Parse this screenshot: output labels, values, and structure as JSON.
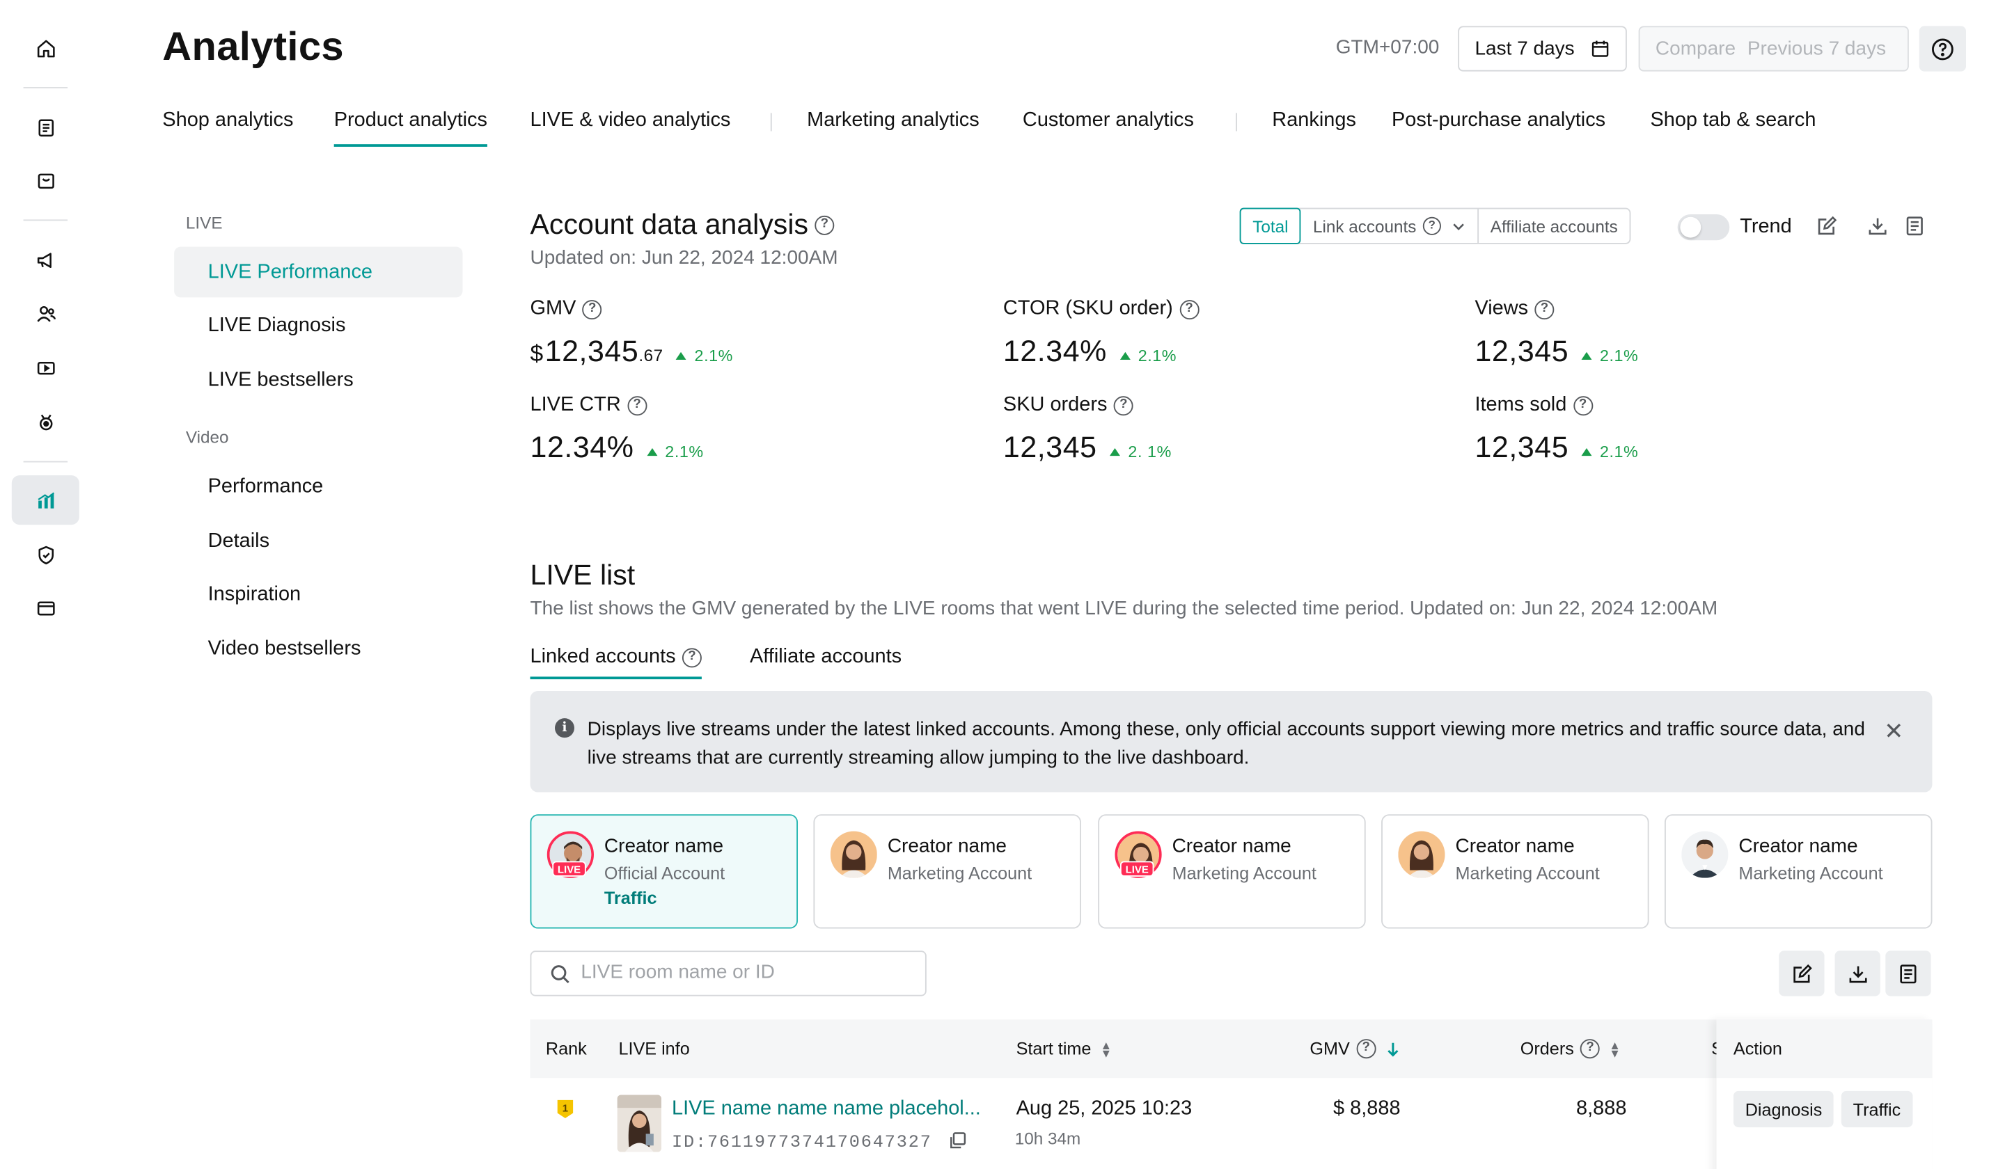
{
  "header": {
    "title": "Analytics",
    "timezone": "GTM+07:00",
    "date_range": "Last 7 days",
    "compare_label": "Compare",
    "compare_range": "Previous 7 days"
  },
  "tabs": [
    {
      "label": "Shop analytics"
    },
    {
      "label": "Product analytics"
    },
    {
      "label": "LIVE & video analytics"
    },
    {
      "label": "Marketing analytics"
    },
    {
      "label": "Customer analytics"
    },
    {
      "label": "Rankings"
    },
    {
      "label": "Post-purchase analytics"
    },
    {
      "label": "Shop tab &  search"
    }
  ],
  "sidenav": {
    "live_group": "LIVE",
    "live_items": [
      "LIVE Performance",
      "LIVE Diagnosis",
      "LIVE bestsellers"
    ],
    "video_group": "Video",
    "video_items": [
      "Performance",
      "Details",
      "Inspiration",
      "Video bestsellers"
    ]
  },
  "account": {
    "title": "Account data analysis",
    "updated": "Updated on: Jun 22, 2024 12:00AM",
    "segments": [
      "Total",
      "Link accounts",
      "Affiliate accounts"
    ],
    "trend_label": "Trend",
    "metrics": [
      {
        "label": "GMV",
        "currency": "$",
        "value": "12,345",
        "decimal": ".67",
        "change": "2.1%"
      },
      {
        "label": "CTOR (SKU order)",
        "value": "12.34%",
        "change": "2.1%"
      },
      {
        "label": "Views",
        "value": "12,345",
        "change": "2.1%"
      },
      {
        "label": "LIVE CTR",
        "value": "12.34%",
        "change": "2.1%"
      },
      {
        "label": "SKU orders",
        "value": "12,345",
        "change": "2. 1%"
      },
      {
        "label": "Items sold",
        "value": "12,345",
        "change": "2.1%"
      }
    ]
  },
  "live_list": {
    "title": "LIVE list",
    "description": "The list shows the GMV generated by the LIVE rooms that went LIVE during the selected time period. Updated on: Jun 22, 2024 12:00AM",
    "subtabs": [
      "Linked accounts",
      "Affiliate accounts"
    ],
    "banner": "Displays live streams under the latest linked accounts. Among these, only official accounts support viewing more metrics and traffic source data, and live streams that are currently streaming allow jumping to the live dashboard.",
    "creators": [
      {
        "name": "Creator name",
        "type": "Official Account",
        "link": "Traffic",
        "live": "LIVE"
      },
      {
        "name": "Creator name",
        "type": "Marketing Account"
      },
      {
        "name": "Creator name",
        "type": "Marketing Account",
        "live": "LIVE"
      },
      {
        "name": "Creator name",
        "type": "Marketing Account"
      },
      {
        "name": "Creator name",
        "type": "Marketing Account"
      }
    ],
    "search_placeholder": "LIVE room name or ID",
    "columns": [
      "Rank",
      "LIVE info",
      "Start time",
      "GMV",
      "Orders",
      "S",
      "Action"
    ],
    "rows": [
      {
        "rank": "1",
        "name": "LIVE name name name placehol...",
        "id": "ID:7611977374170647327",
        "start_time": "Aug 25, 2025 10:23",
        "duration": "10h 34m",
        "gmv": "$ 8,888",
        "orders": "8,888",
        "actions": [
          "Diagnosis",
          "Traffic"
        ]
      }
    ]
  },
  "colors": {
    "accent": "#009995",
    "positive": "#1a9d4a",
    "live": "#fe2c55",
    "badge": "#f5c400"
  }
}
